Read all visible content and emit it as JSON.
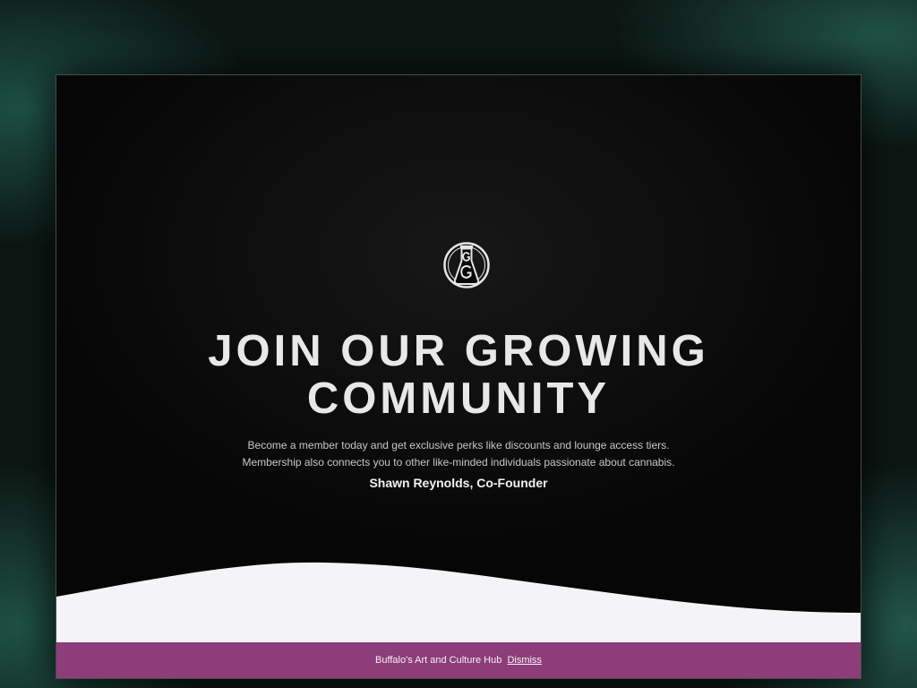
{
  "hero": {
    "logo_icon": "flask-monogram-logo",
    "headline_line1": "JOIN OUR GROWING",
    "headline_line2": "COMMUNITY",
    "body_line1": "Become a member today and get exclusive perks like discounts and lounge access tiers.",
    "body_line2": "Membership also connects you to other like-minded individuals passionate about cannabis.",
    "signature": "Shawn Reynolds, Co-Founder"
  },
  "banner": {
    "text": "Buffalo's Art and Culture Hub",
    "dismiss_label": "Dismiss",
    "background_color": "#8d3d7a"
  },
  "colors": {
    "hero_background": "#060606",
    "wave_fill": "#f4f4f6",
    "headline_text": "#e8e8e8"
  }
}
